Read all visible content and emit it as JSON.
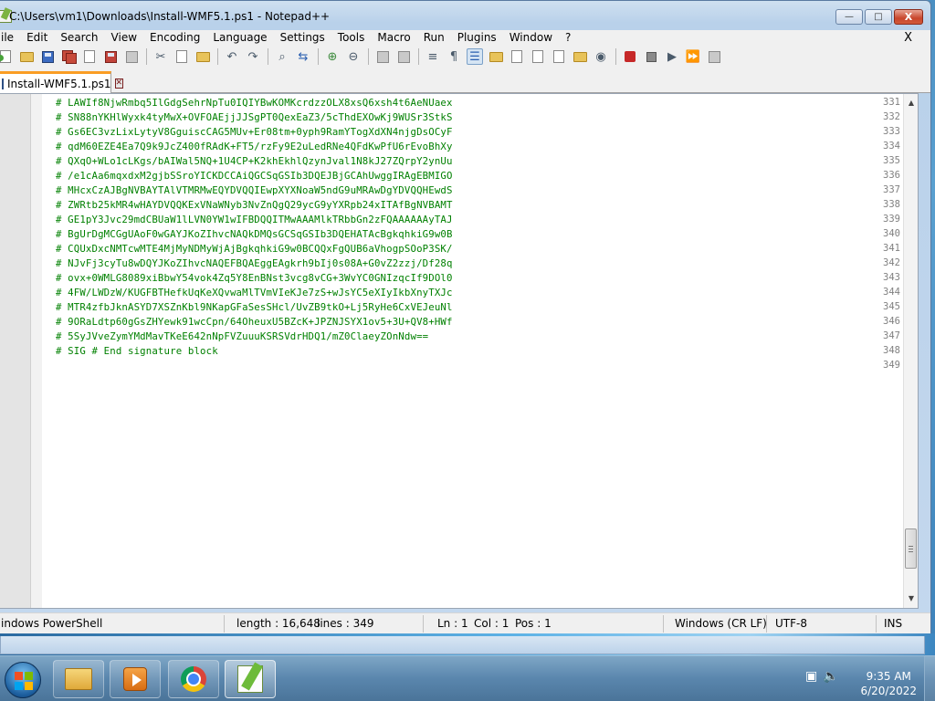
{
  "window": {
    "title": "C:\\Users\\vm1\\Downloads\\Install-WMF5.1.ps1 - Notepad++",
    "minimize_glyph": "—",
    "maximize_glyph": "□",
    "close_glyph": "X"
  },
  "menu": {
    "items": [
      "ile",
      "Edit",
      "Search",
      "View",
      "Encoding",
      "Language",
      "Settings",
      "Tools",
      "Macro",
      "Run",
      "Plugins",
      "Window",
      "?"
    ],
    "close_doc": "X"
  },
  "tab": {
    "label": "Install-WMF5.1.ps1",
    "close_glyph": "✕"
  },
  "editor": {
    "lines": [
      {
        "num": "331",
        "text": "# LAWIf8NjwRmbq5IlGdgSehrNpTu0IQIYBwKOMKcrdzzOLX8xsQ6xsh4t6AeNUaex"
      },
      {
        "num": "332",
        "text": "# SN88nYKHlWyxk4tyMwX+OVFOAEjjJJSgPT0QexEaZ3/5cThdEXOwKj9WUSr3StkS"
      },
      {
        "num": "333",
        "text": "# Gs6EC3vzLixLytyV8GguiscCAG5MUv+Er08tm+0yph9RamYTogXdXN4njgDsOCyF"
      },
      {
        "num": "334",
        "text": "# qdM60EZE4Ea7Q9k9JcZ400fRAdK+FT5/rzFy9E2uLedRNe4QFdKwPfU6rEvoBhXy"
      },
      {
        "num": "335",
        "text": "# QXqO+WLo1cLKgs/bAIWal5NQ+1U4CP+K2khEkhlQzynJval1N8kJ27ZQrpY2ynUu"
      },
      {
        "num": "336",
        "text": "# /e1cAa6mqxdxM2gjbSSroYICKDCCAiQGCSqGSIb3DQEJBjGCAhUwggIRAgEBMIGO"
      },
      {
        "num": "337",
        "text": "# MHcxCzAJBgNVBAYTAlVTMRMwEQYDVQQIEwpXYXNoaW5ndG9uMRAwDgYDVQQHEwdS"
      },
      {
        "num": "338",
        "text": "# ZWRtb25kMR4wHAYDVQQKExVNaWNyb3NvZnQgQ29ycG9yYXRpb24xITAfBgNVBAMT"
      },
      {
        "num": "339",
        "text": "# GE1pY3Jvc29mdCBUaW1lLVN0YW1wIFBDQQITMwAAAMlkTRbbGn2zFQAAAAAAyTAJ"
      },
      {
        "num": "340",
        "text": "# BgUrDgMCGgUAoF0wGAYJKoZIhvcNAQkDMQsGCSqGSIb3DQEHATAcBgkqhkiG9w0B"
      },
      {
        "num": "341",
        "text": "# CQUxDxcNMTcwMTE4MjMyNDMyWjAjBgkqhkiG9w0BCQQxFgQUB6aVhogpSOoP3SK/"
      },
      {
        "num": "342",
        "text": "# NJvFj3cyTu8wDQYJKoZIhvcNAQEFBQAEggEAgkrh9bIj0s08A+G0vZ2zzj/Df28q"
      },
      {
        "num": "343",
        "text": "# ovx+0WMLG8089xiBbwY54vok4Zq5Y8EnBNst3vcg8vCG+3WvYC0GNIzqcIf9DOl0"
      },
      {
        "num": "344",
        "text": "# 4FW/LWDzW/KUGFBTHefkUqKeXQvwaMlTVmVIeKJe7zS+wJsYC5eXIyIkbXnyTXJc"
      },
      {
        "num": "345",
        "text": "# MTR4zfbJknASYD7XSZnKbl9NKapGFaSesSHcl/UvZB9tkO+Lj5RyHe6CxVEJeuNl"
      },
      {
        "num": "346",
        "text": "# 9ORaLdtp60gGsZHYewk91wcCpn/64OheuxU5BZcK+JPZNJSYX1ov5+3U+QV8+HWf"
      },
      {
        "num": "347",
        "text": "# 5SyJVveZymYMdMavTKeE642nNpFVZuuuKSRSVdrHDQ1/mZ0ClaeyZOnNdw=="
      },
      {
        "num": "348",
        "text": "# SIG # End signature block"
      },
      {
        "num": "349",
        "text": ""
      }
    ]
  },
  "status": {
    "language": "indows PowerShell",
    "length": "length : 16,648",
    "lines": "lines : 349",
    "ln": "Ln : 1",
    "col": "Col : 1",
    "pos": "Pos : 1",
    "eol": "Windows (CR LF)",
    "encoding": "UTF-8",
    "mode": "INS"
  },
  "taskbar": {
    "time": "9:35 AM",
    "date": "6/20/2022"
  }
}
